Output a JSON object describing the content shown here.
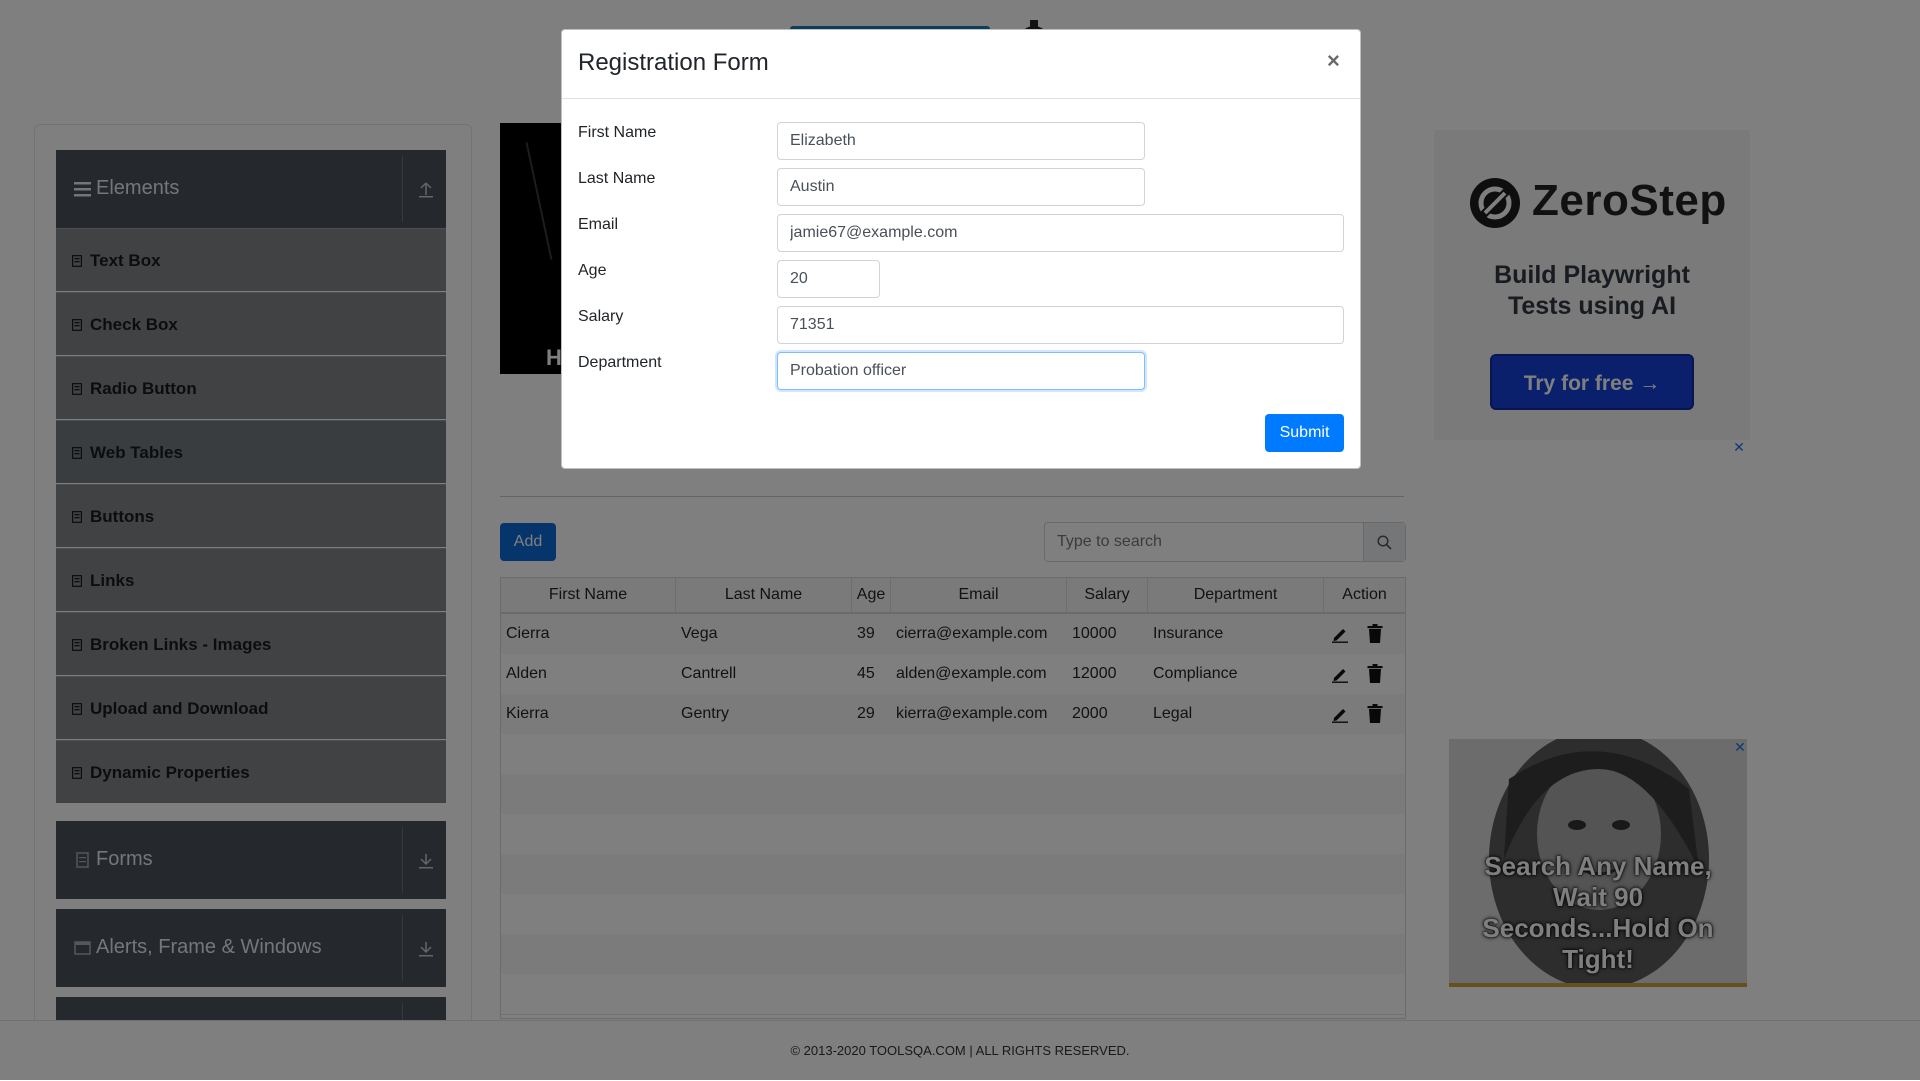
{
  "colors": {
    "accent": "#007bff",
    "sidebar_header": "#4a5058",
    "sidebar_item": "#808488",
    "overlay": "rgba(0,0,0,0.5)"
  },
  "sidebar": {
    "elements_header": {
      "label": "Elements",
      "icon": "list-icon",
      "arrow": "collapse-up-icon"
    },
    "items": [
      {
        "label": "Text Box",
        "icon": "item-icon"
      },
      {
        "label": "Check Box",
        "icon": "item-icon"
      },
      {
        "label": "Radio Button",
        "icon": "item-icon"
      },
      {
        "label": "Web Tables",
        "icon": "item-icon",
        "active": true
      },
      {
        "label": "Buttons",
        "icon": "item-icon"
      },
      {
        "label": "Links",
        "icon": "item-icon"
      },
      {
        "label": "Broken Links - Images",
        "icon": "item-icon"
      },
      {
        "label": "Upload and Download",
        "icon": "item-icon"
      },
      {
        "label": "Dynamic Properties",
        "icon": "item-icon"
      }
    ],
    "groups": [
      {
        "label": "Forms",
        "icon": "form-icon",
        "arrow": "expand-down-icon"
      },
      {
        "label": "Alerts, Frame & Windows",
        "icon": "window-icon",
        "arrow": "expand-down-icon"
      }
    ]
  },
  "toolbar": {
    "add_label": "Add",
    "search_placeholder": "Type to search",
    "search_icon": "search-icon"
  },
  "table": {
    "columns": [
      "First Name",
      "Last Name",
      "Age",
      "Email",
      "Salary",
      "Department",
      "Action"
    ],
    "rows": [
      {
        "first": "Cierra",
        "last": "Vega",
        "age": "39",
        "email": "cierra@example.com",
        "salary": "10000",
        "department": "Insurance"
      },
      {
        "first": "Alden",
        "last": "Cantrell",
        "age": "45",
        "email": "alden@example.com",
        "salary": "12000",
        "department": "Compliance"
      },
      {
        "first": "Kierra",
        "last": "Gentry",
        "age": "29",
        "email": "kierra@example.com",
        "salary": "2000",
        "department": "Legal"
      }
    ],
    "action_icons": [
      "edit-icon",
      "delete-icon"
    ]
  },
  "ads": {
    "ad1": {
      "brand": "ZeroStep",
      "tagline": "Build Playwright Tests using AI",
      "cta": "Try for free →"
    },
    "ad2": {
      "text": "Search Any Name, Wait 90 Seconds...Hold On Tight!"
    },
    "close": "✕"
  },
  "banner": {
    "text": "H"
  },
  "footer": {
    "text": "© 2013-2020 TOOLSQA.COM | ALL RIGHTS RESERVED."
  },
  "modal": {
    "title": "Registration Form",
    "close": "×",
    "submit_label": "Submit",
    "fields": {
      "first_name": {
        "label": "First Name",
        "value": "Elizabeth"
      },
      "last_name": {
        "label": "Last Name",
        "value": "Austin"
      },
      "email": {
        "label": "Email",
        "value": "jamie67@example.com"
      },
      "age": {
        "label": "Age",
        "value": "20"
      },
      "salary": {
        "label": "Salary",
        "value": "71351"
      },
      "department": {
        "label": "Department",
        "value": "Probation officer"
      }
    }
  }
}
